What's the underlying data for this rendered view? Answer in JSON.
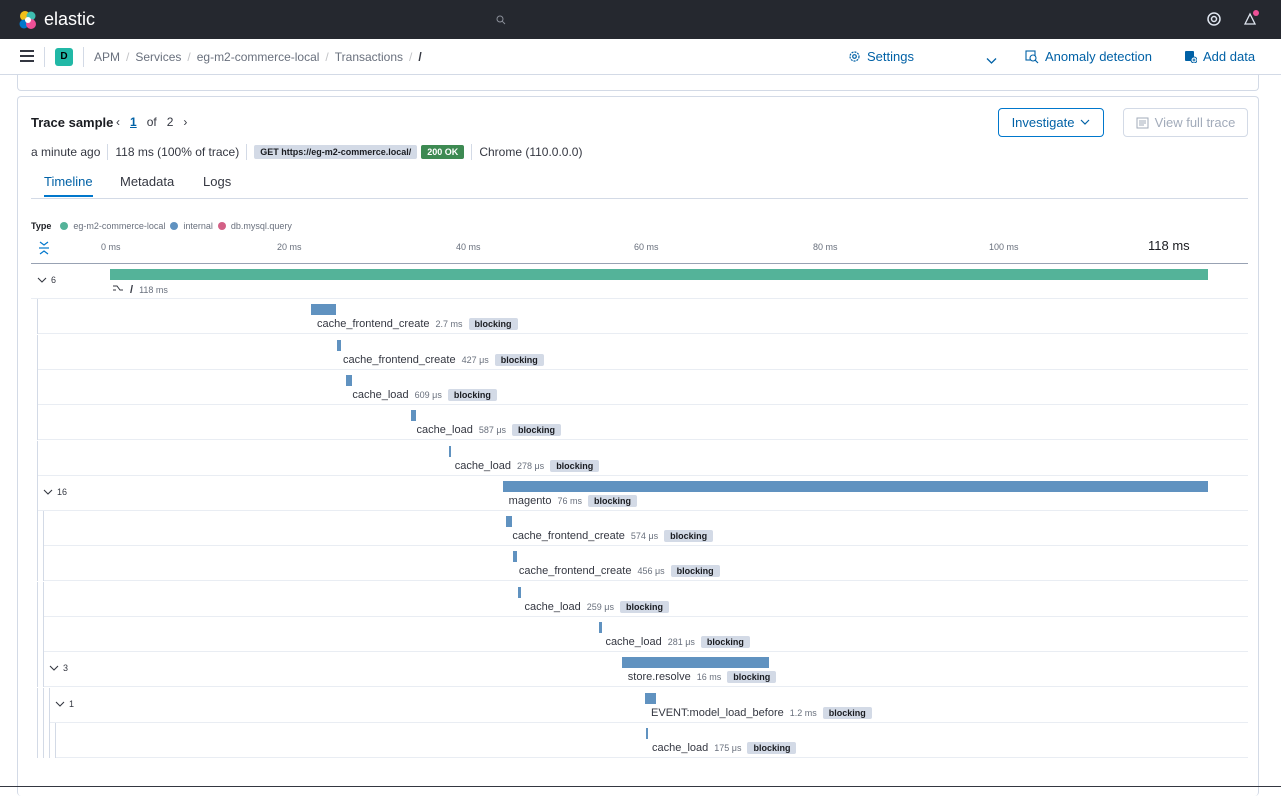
{
  "header": {
    "brand": "elastic"
  },
  "breadcrumb": {
    "space": "D",
    "items": [
      "APM",
      "Services",
      "eg-m2-commerce-local",
      "Transactions"
    ],
    "current": "/"
  },
  "header_links": {
    "settings": "Settings",
    "anomaly": "Anomaly detection",
    "add_data": "Add data"
  },
  "trace": {
    "title": "Trace sample",
    "current_page": "1",
    "of_label": "of",
    "total_pages": "2",
    "investigate": "Investigate",
    "view_full": "View full trace",
    "age": "a minute ago",
    "duration": "118 ms (100% of trace)",
    "request": "GET https://eg-m2-commerce.local/",
    "status": "200 OK",
    "browser": "Chrome (110.0.0.0)"
  },
  "tabs": [
    "Timeline",
    "Metadata",
    "Logs"
  ],
  "legend": {
    "type_label": "Type",
    "items": [
      {
        "label": "eg-m2-commerce-local",
        "color": "#54b399"
      },
      {
        "label": "internal",
        "color": "#6092c0"
      },
      {
        "label": "db.mysql.query",
        "color": "#d36086"
      }
    ]
  },
  "axis": {
    "ticks": [
      "0 ms",
      "20 ms",
      "40 ms",
      "60 ms",
      "80 ms",
      "100 ms"
    ],
    "total": "118 ms"
  },
  "colors": {
    "service": "#54b399",
    "internal": "#6092c0"
  },
  "spans": [
    {
      "name": "/",
      "duration": "118 ms",
      "toggle": "6",
      "start_ms": 0,
      "dur_ms": 118,
      "blocking": "",
      "color": "service",
      "depth": 0
    },
    {
      "name": "cache_frontend_create",
      "duration": "2.7 ms",
      "toggle": "",
      "start_ms": 21.6,
      "dur_ms": 2.7,
      "blocking": "blocking",
      "color": "internal",
      "depth": 1
    },
    {
      "name": "cache_frontend_create",
      "duration": "427 μs",
      "toggle": "",
      "start_ms": 24.4,
      "dur_ms": 0.43,
      "blocking": "blocking",
      "color": "internal",
      "depth": 1
    },
    {
      "name": "cache_load",
      "duration": "609 μs",
      "toggle": "",
      "start_ms": 25.4,
      "dur_ms": 0.61,
      "blocking": "blocking",
      "color": "internal",
      "depth": 1
    },
    {
      "name": "cache_load",
      "duration": "587 μs",
      "toggle": "",
      "start_ms": 32.3,
      "dur_ms": 0.59,
      "blocking": "blocking",
      "color": "internal",
      "depth": 1
    },
    {
      "name": "cache_load",
      "duration": "278 μs",
      "toggle": "",
      "start_ms": 36.4,
      "dur_ms": 0.28,
      "blocking": "blocking",
      "color": "internal",
      "depth": 1
    },
    {
      "name": "magento",
      "duration": "76 ms",
      "toggle": "16",
      "start_ms": 42.2,
      "dur_ms": 75.8,
      "blocking": "blocking",
      "color": "internal",
      "depth": 1
    },
    {
      "name": "cache_frontend_create",
      "duration": "574 μs",
      "toggle": "",
      "start_ms": 42.6,
      "dur_ms": 0.57,
      "blocking": "blocking",
      "color": "internal",
      "depth": 2
    },
    {
      "name": "cache_frontend_create",
      "duration": "456 μs",
      "toggle": "",
      "start_ms": 43.3,
      "dur_ms": 0.46,
      "blocking": "blocking",
      "color": "internal",
      "depth": 2
    },
    {
      "name": "cache_load",
      "duration": "259 μs",
      "toggle": "",
      "start_ms": 43.9,
      "dur_ms": 0.26,
      "blocking": "blocking",
      "color": "internal",
      "depth": 2
    },
    {
      "name": "cache_load",
      "duration": "281 μs",
      "toggle": "",
      "start_ms": 52.6,
      "dur_ms": 0.28,
      "blocking": "blocking",
      "color": "internal",
      "depth": 2
    },
    {
      "name": "store.resolve",
      "duration": "16 ms",
      "toggle": "3",
      "start_ms": 55.0,
      "dur_ms": 15.8,
      "blocking": "blocking",
      "color": "internal",
      "depth": 2
    },
    {
      "name": "EVENT:model_load_before",
      "duration": "1.2 ms",
      "toggle": "1",
      "start_ms": 57.5,
      "dur_ms": 1.2,
      "blocking": "blocking",
      "color": "internal",
      "depth": 3
    },
    {
      "name": "cache_load",
      "duration": "175 μs",
      "toggle": "",
      "start_ms": 57.6,
      "dur_ms": 0.18,
      "blocking": "blocking",
      "color": "internal",
      "depth": 4
    }
  ]
}
